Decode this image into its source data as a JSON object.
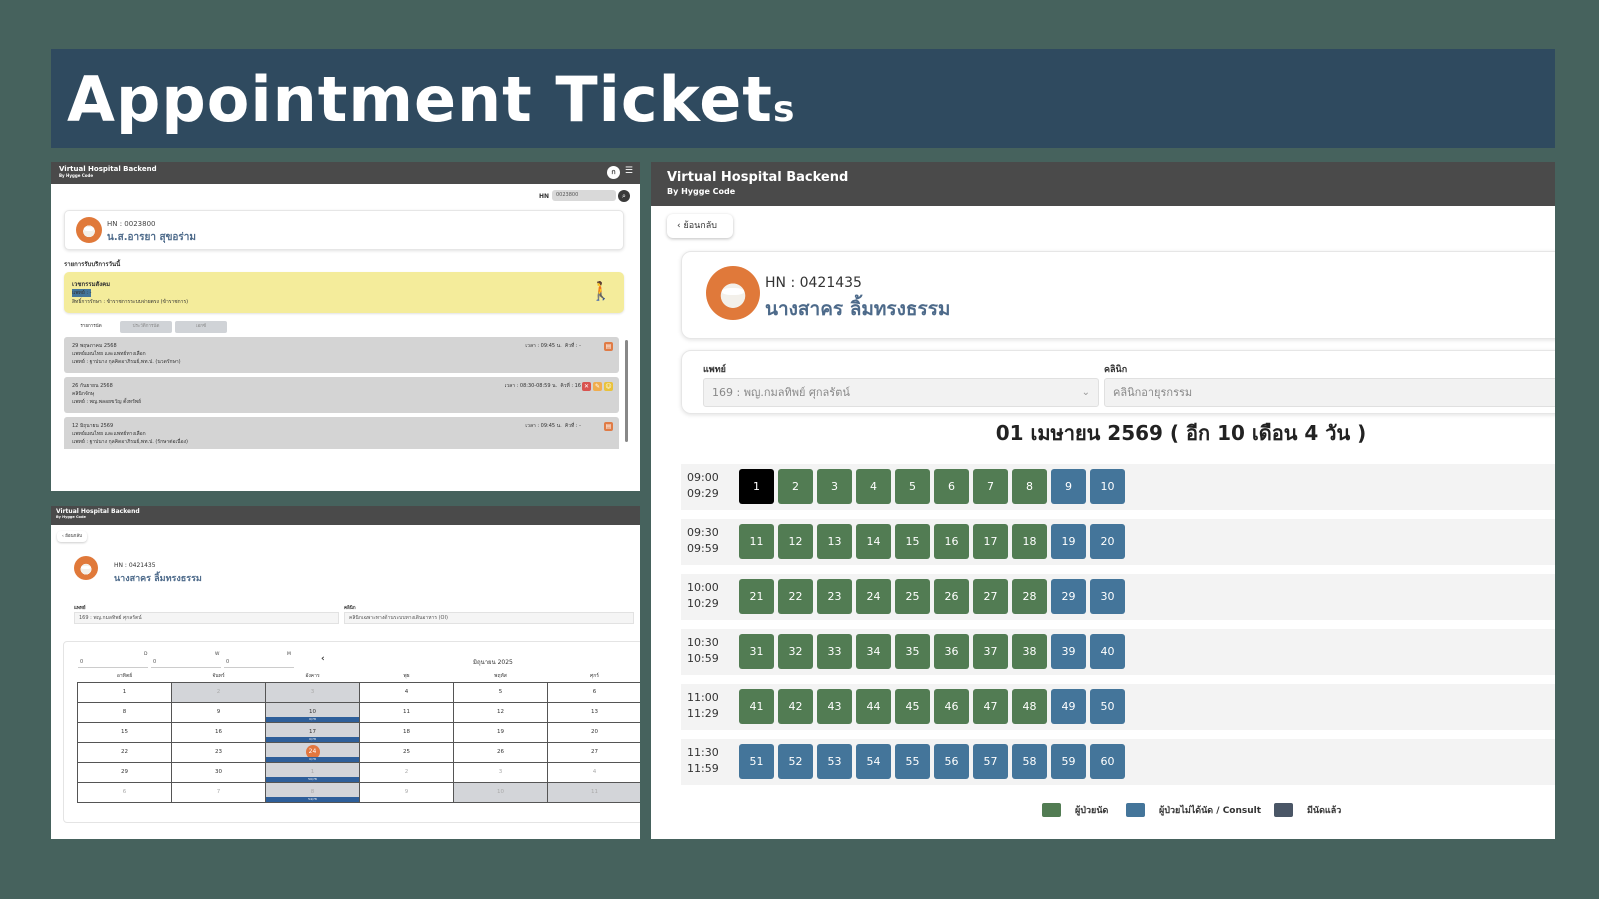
{
  "banner": {
    "title": "Appointment Ticket",
    "title_tail": "s"
  },
  "colors": {
    "page_bg": "#46625d",
    "banner": "#2f4a5f",
    "appbar": "#4a4a4a",
    "green": "#527c53",
    "blue": "#44759a",
    "booked": "#000000",
    "legend_booked": "#4a5666"
  },
  "app": {
    "title": "Virtual Hospital Backend",
    "subtitle": "By Hygge Code"
  },
  "panel1": {
    "user_initial": "ก",
    "hn_label": "HN",
    "hn_value": "0023800",
    "patient_hn": "HN : 0023800",
    "patient_name": "น.ส.อารยา สุขอร่าม",
    "section_title": "รายการรับบริการวันนี้",
    "today_service": {
      "clinic": "เวชกรรมสังคม",
      "doctor": "แพทย์ : -",
      "right": "สิทธิ์การรักษา : ข้าราชการระบบจ่ายตรง (ข้าราชการ)"
    },
    "tabs": [
      "รายการนัด",
      "ประวัติการนัด",
      "เอกซ์"
    ],
    "appointments": [
      {
        "date": "29 พฤษภาคม 2568",
        "clinic": "แพทย์แผนไทย และแพทย์ทางเลือก",
        "doctor": "แพทย์ : ฐาปนาง กุลคิดอาภิรมย์,พท.ป. (นวดรักษา)",
        "time": "เวลา : 09:45 น.",
        "slot": "คิวที่ : -"
      },
      {
        "date": "26 กันยายน 2568",
        "clinic": "คลินิกจักษุ",
        "doctor": "แพทย์ : พญ.พลอยขวัญ ตั้งทรัพย์",
        "time": "เวลา : 08:30-08:59 น.",
        "slot": "คิวที่ : 16"
      },
      {
        "date": "12 มิถุนายน 2569",
        "clinic": "แพทย์แผนไทย และแพทย์ทางเลือก",
        "doctor": "แพทย์ : ฐาปนาง กุลคิดอาภิรมย์,พท.ป. (รักษาต่อเนื่อง)",
        "time": "เวลา : 09:45 น.",
        "slot": "คิวที่ : -"
      }
    ]
  },
  "panel2": {
    "back_label": "‹ ย้อนกลับ",
    "patient_hn": "HN : 0421435",
    "patient_name": "นางสาคร ลิ้มทรงธรรม",
    "doctor_label": "แพทย์",
    "doctor_value": "169 : พญ.กมลทิพย์ ศุกลรัตน์",
    "clinic_label": "คลินิก",
    "clinic_value": "คลินิกเฉพาะทางด้านระบบทางเดินอาหาร (OI)",
    "dwm_labels": [
      "D",
      "W",
      "M"
    ],
    "dwm_values": [
      "0",
      "0",
      "0"
    ],
    "month": "มิถุนายน 2025",
    "weekdays": [
      "อาทิตย์",
      "จันทร์",
      "อังคาร",
      "พุธ",
      "พฤหัส",
      "ศุกร์"
    ],
    "weeks": [
      [
        "1",
        "2",
        "3",
        "4",
        "5",
        "6"
      ],
      [
        "8",
        "9",
        "10",
        "11",
        "12",
        "13"
      ],
      [
        "15",
        "16",
        "17",
        "18",
        "19",
        "20"
      ],
      [
        "22",
        "23",
        "24",
        "25",
        "26",
        "27"
      ],
      [
        "29",
        "30",
        "1",
        "2",
        "3",
        "4"
      ],
      [
        "6",
        "7",
        "8",
        "9",
        "10",
        "11"
      ]
    ],
    "quota_labels": [
      "0/78",
      "0/78",
      "0/78",
      "50/78",
      "54/78"
    ]
  },
  "panel3": {
    "back_label": "ย้อนกลับ",
    "patient_hn": "HN : 0421435",
    "patient_name": "นางสาคร ลิ้มทรงธรรม",
    "doctor_label": "แพทย์",
    "doctor_value": "169 : พญ.กมลทิพย์ ศุกลรัตน์",
    "clinic_label": "คลินิก",
    "clinic_value": "คลินิกอายุรกรรม",
    "date_heading": "01 เมษายน 2569 ( อีก 10 เดือน 4 วัน )",
    "slots": [
      {
        "start": "09:00",
        "end": "09:29",
        "numbers": [
          "1",
          "2",
          "3",
          "4",
          "5",
          "6",
          "7",
          "8",
          "9",
          "10"
        ],
        "status": [
          "booked",
          "green",
          "green",
          "green",
          "green",
          "green",
          "green",
          "green",
          "blue",
          "blue"
        ]
      },
      {
        "start": "09:30",
        "end": "09:59",
        "numbers": [
          "11",
          "12",
          "13",
          "14",
          "15",
          "16",
          "17",
          "18",
          "19",
          "20"
        ],
        "status": [
          "green",
          "green",
          "green",
          "green",
          "green",
          "green",
          "green",
          "green",
          "blue",
          "blue"
        ]
      },
      {
        "start": "10:00",
        "end": "10:29",
        "numbers": [
          "21",
          "22",
          "23",
          "24",
          "25",
          "26",
          "27",
          "28",
          "29",
          "30"
        ],
        "status": [
          "green",
          "green",
          "green",
          "green",
          "green",
          "green",
          "green",
          "green",
          "blue",
          "blue"
        ]
      },
      {
        "start": "10:30",
        "end": "10:59",
        "numbers": [
          "31",
          "32",
          "33",
          "34",
          "35",
          "36",
          "37",
          "38",
          "39",
          "40"
        ],
        "status": [
          "green",
          "green",
          "green",
          "green",
          "green",
          "green",
          "green",
          "green",
          "blue",
          "blue"
        ]
      },
      {
        "start": "11:00",
        "end": "11:29",
        "numbers": [
          "41",
          "42",
          "43",
          "44",
          "45",
          "46",
          "47",
          "48",
          "49",
          "50"
        ],
        "status": [
          "green",
          "green",
          "green",
          "green",
          "green",
          "green",
          "green",
          "green",
          "blue",
          "blue"
        ]
      },
      {
        "start": "11:30",
        "end": "11:59",
        "numbers": [
          "51",
          "52",
          "53",
          "54",
          "55",
          "56",
          "57",
          "58",
          "59",
          "60"
        ],
        "status": [
          "blue",
          "blue",
          "blue",
          "blue",
          "blue",
          "blue",
          "blue",
          "blue",
          "blue",
          "blue"
        ]
      }
    ],
    "legend": [
      {
        "label": "ผู้ป่วยนัด",
        "color": "#527c53"
      },
      {
        "label": "ผู้ป่วยไม่ได้นัด / Consult",
        "color": "#44759a"
      },
      {
        "label": "มีนัดแล้ว",
        "color": "#4a5666"
      }
    ]
  }
}
